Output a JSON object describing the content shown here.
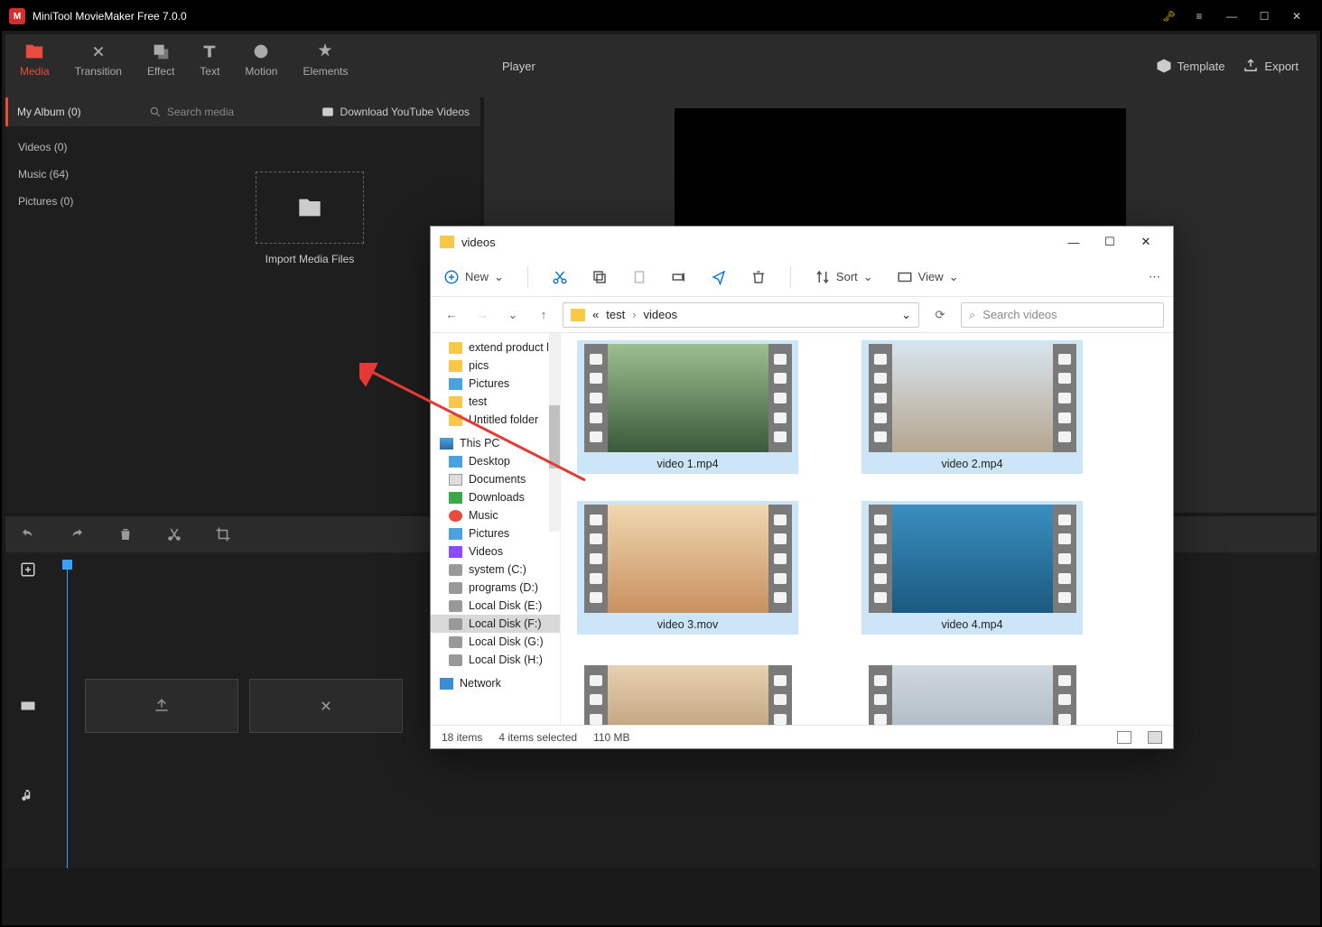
{
  "window": {
    "title": "MiniTool MovieMaker Free 7.0.0"
  },
  "tabs": {
    "media": "Media",
    "transition": "Transition",
    "effect": "Effect",
    "text": "Text",
    "motion": "Motion",
    "elements": "Elements"
  },
  "player": {
    "label": "Player",
    "template": "Template",
    "export": "Export"
  },
  "subhead": {
    "album": "My Album (0)",
    "search_placeholder": "Search media",
    "download": "Download YouTube Videos"
  },
  "categories": {
    "videos": "Videos (0)",
    "music": "Music (64)",
    "pictures": "Pictures (0)"
  },
  "drop": {
    "label": "Import Media Files"
  },
  "explorer": {
    "title": "videos",
    "cmd": {
      "new": "New",
      "sort": "Sort",
      "view": "View"
    },
    "breadcrumb": {
      "root": "«",
      "p1": "test",
      "p2": "videos"
    },
    "search_placeholder": "Search videos",
    "tree": {
      "ext": "extend product li",
      "pics": "pics",
      "pictures": "Pictures",
      "test": "test",
      "untitled": "Untitled folder",
      "thispc": "This PC",
      "desktop": "Desktop",
      "documents": "Documents",
      "downloads": "Downloads",
      "music": "Music",
      "pictures2": "Pictures",
      "videos": "Videos",
      "system": "system (C:)",
      "programs": "programs (D:)",
      "lde": "Local Disk (E:)",
      "ldf": "Local Disk (F:)",
      "ldg": "Local Disk (G:)",
      "ldh": "Local Disk (H:)",
      "network": "Network"
    },
    "files": {
      "f1": "video 1.mp4",
      "f2": "video 2.mp4",
      "f3": "video 3.mov",
      "f4": "video 4.mp4",
      "f5": "",
      "f6": ""
    },
    "status": {
      "items": "18 items",
      "selected": "4 items selected",
      "size": "110 MB"
    }
  }
}
